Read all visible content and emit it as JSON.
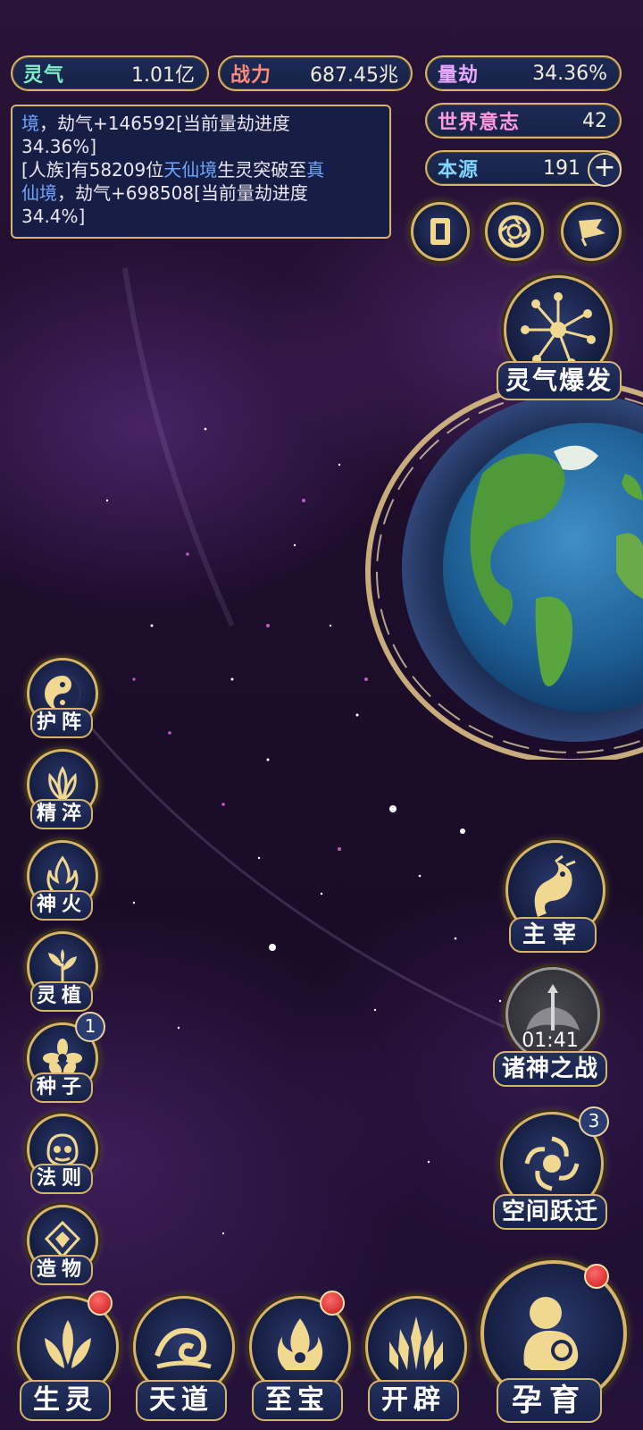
{
  "stats": {
    "lingqi": {
      "label": "灵气",
      "value": "1.01亿",
      "color": "#7ef0c8"
    },
    "zhanli": {
      "label": "战力",
      "value": "687.45兆",
      "color": "#ff8a7a"
    },
    "liangjie": {
      "label": "量劫",
      "value": "34.36%",
      "color": "#e9a8ff"
    },
    "shijie": {
      "label": "世界意志",
      "value": "42",
      "color": "#ff9ae0"
    },
    "benyuan": {
      "label": "本源",
      "value": "191",
      "color": "#7fd6ff"
    }
  },
  "log": {
    "line1_hl": "境",
    "line1_rest": "，劫气+146592[当前量劫进度",
    "line2": "34.36%]",
    "line3_a": "[人族]有58209位",
    "line3_hl": "天仙境",
    "line3_b": "生灵突破至",
    "line3_hl2": "真",
    "line4_hl": "仙境",
    "line4_rest": "，劫气+698508[当前量劫进度",
    "line5": "34.4%]"
  },
  "burst_label": "灵气爆发",
  "side_buttons": [
    {
      "label": "护阵",
      "icon": "yin-yang-icon"
    },
    {
      "label": "精淬",
      "icon": "lotus-flame-icon"
    },
    {
      "label": "神火",
      "icon": "fire-icon"
    },
    {
      "label": "灵植",
      "icon": "plant-icon"
    },
    {
      "label": "种子",
      "icon": "seed-flower-icon",
      "badge": "1"
    },
    {
      "label": "法则",
      "icon": "rune-mask-icon"
    },
    {
      "label": "造物",
      "icon": "diamond-crest-icon"
    }
  ],
  "right_buttons": {
    "zhuzai": {
      "label": "主宰"
    },
    "zhushen": {
      "label": "诸神之战",
      "timer": "01:41"
    },
    "kongjian": {
      "label": "空间跃迁",
      "badge": "3"
    }
  },
  "bottom_buttons": [
    {
      "label": "生灵",
      "icon": "phoenix-lotus-icon"
    },
    {
      "label": "天道",
      "icon": "wave-swirl-icon"
    },
    {
      "label": "至宝",
      "icon": "treasure-flame-icon"
    },
    {
      "label": "开辟",
      "icon": "axe-flame-icon"
    }
  ],
  "yunyu_label": "孕育"
}
